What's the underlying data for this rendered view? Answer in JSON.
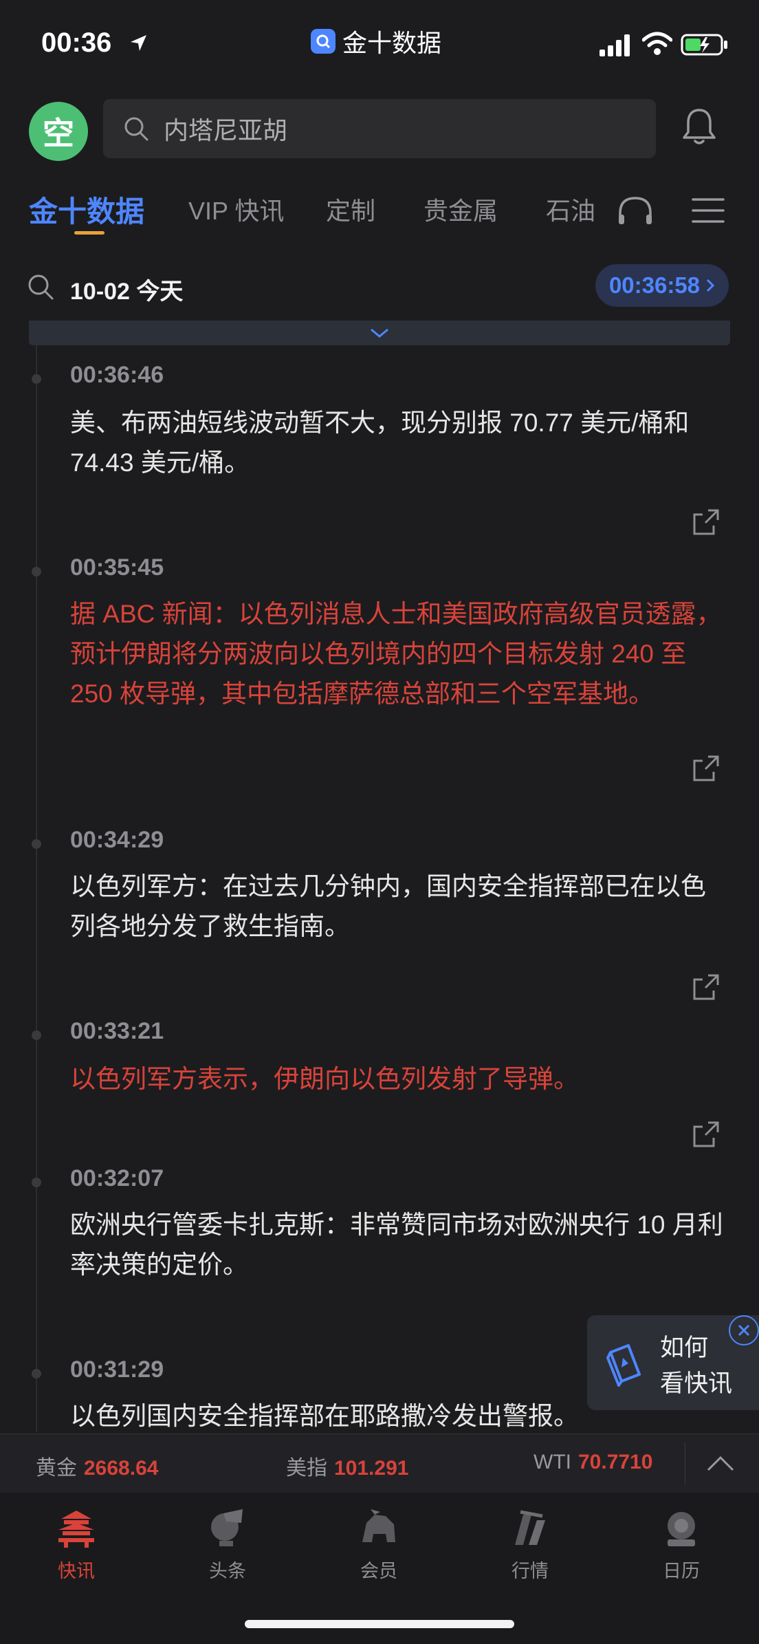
{
  "status_bar": {
    "time": "00:36",
    "app_name": "金十数据"
  },
  "header": {
    "avatar_char": "空",
    "search_placeholder": "内塔尼亚胡"
  },
  "tabs": [
    {
      "label": "金十数据",
      "active": true
    },
    {
      "label": "VIP 快讯",
      "active": false
    },
    {
      "label": "定制",
      "active": false
    },
    {
      "label": "贵金属",
      "active": false
    },
    {
      "label": "石油",
      "active": false
    }
  ],
  "date_bar": {
    "date": "10-02 今天",
    "current_time": "00:36:58"
  },
  "feed": [
    {
      "time": "00:36:46",
      "text": "美、布两油短线波动暂不大，现分别报 70.77 美元/桶和 74.43 美元/桶。",
      "important": false
    },
    {
      "time": "00:35:45",
      "text": "据 ABC 新闻：以色列消息人士和美国政府高级官员透露，预计伊朗将分两波向以色列境内的四个目标发射 240 至 250 枚导弹，其中包括摩萨德总部和三个空军基地。",
      "important": true
    },
    {
      "time": "00:34:29",
      "text": "以色列军方：在过去几分钟内，国内安全指挥部已在以色列各地分发了救生指南。",
      "important": false
    },
    {
      "time": "00:33:21",
      "text": "以色列军方表示，伊朗向以色列发射了导弹。",
      "important": true
    },
    {
      "time": "00:32:07",
      "text": "欧洲央行管委卡扎克斯：非常赞同市场对欧洲央行 10 月利率决策的定价。",
      "important": false
    },
    {
      "time": "00:31:29",
      "text": "以色列国内安全指挥部在耶路撒冷发出警报。",
      "important": false
    }
  ],
  "float_card": {
    "line1": "如何",
    "line2": "看快讯"
  },
  "ticker": [
    {
      "label": "黄金",
      "value": "2668.64"
    },
    {
      "label": "美指",
      "value": "101.291"
    },
    {
      "label": "WTI",
      "value": "70.7710"
    }
  ],
  "bottom_nav": [
    {
      "label": "快讯",
      "icon": "temple-icon",
      "active": true
    },
    {
      "label": "头条",
      "icon": "headline-icon",
      "active": false
    },
    {
      "label": "会员",
      "icon": "lion-icon",
      "active": false
    },
    {
      "label": "行情",
      "icon": "market-icon",
      "active": false
    },
    {
      "label": "日历",
      "icon": "calendar-icon",
      "active": false
    }
  ],
  "colors": {
    "accent": "#4e86ff",
    "important": "#d9433a",
    "background": "#1c1c1e"
  }
}
